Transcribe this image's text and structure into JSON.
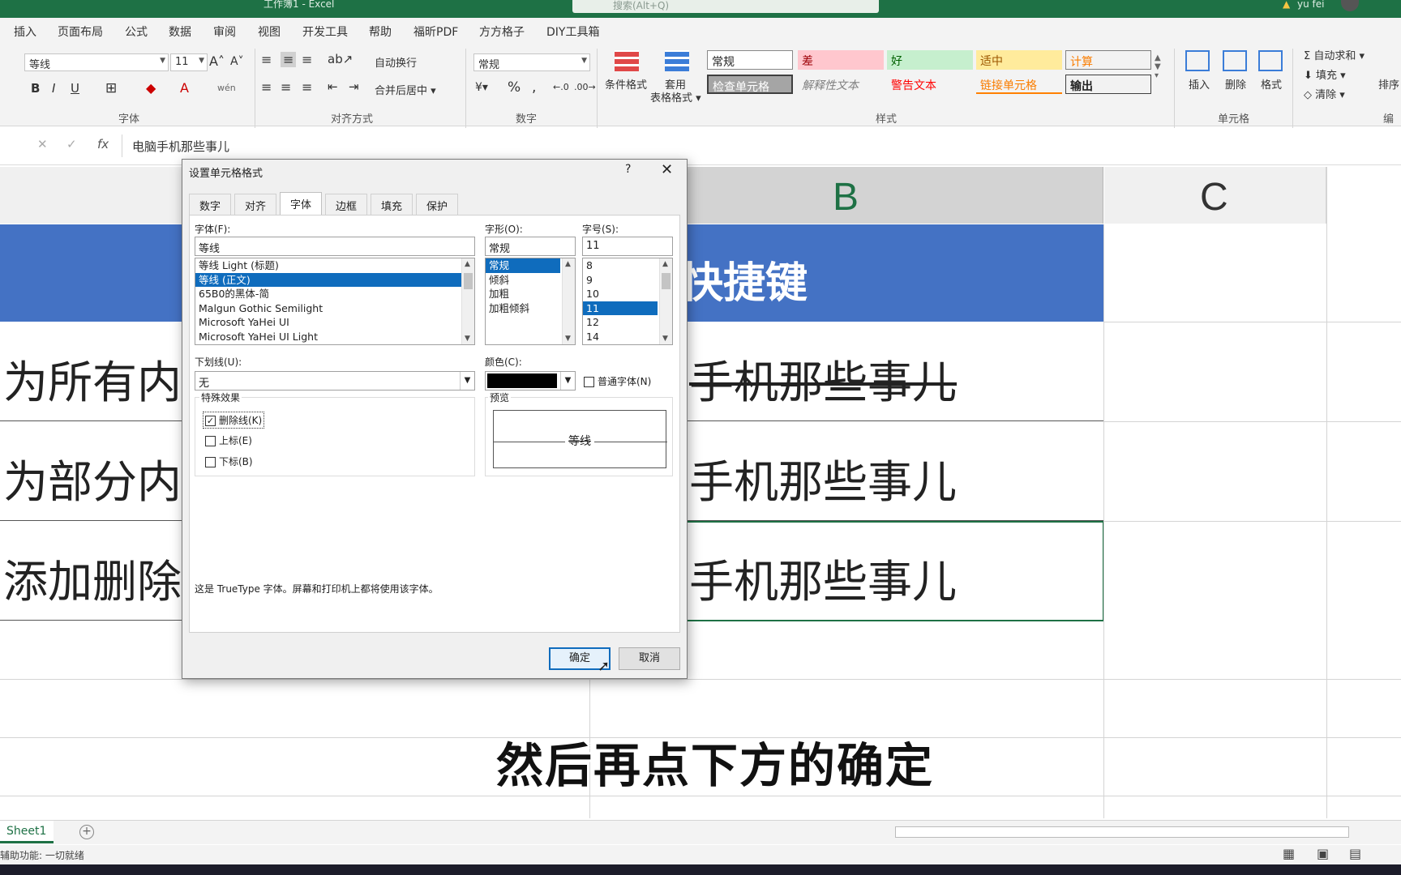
{
  "window": {
    "title": "工作簿1 - Excel",
    "search_placeholder": "搜索(Alt+Q)",
    "user": "yu fei"
  },
  "ribbon": {
    "menus": [
      "插入",
      "页面布局",
      "公式",
      "数据",
      "审阅",
      "视图",
      "开发工具",
      "帮助",
      "福昕PDF",
      "方方格子",
      "DIY工具箱"
    ],
    "font_name": "等线",
    "font_size": "11",
    "wrap_text": "自动换行",
    "merge_center": "合并后居中",
    "number_format": "常规",
    "conditional_format": "条件格式",
    "table_format": "套用\n表格格式",
    "styles": {
      "normal": "常规",
      "bad": "差",
      "good": "好",
      "neutral": "适中",
      "calc": "计算",
      "check": "检查单元格",
      "explain": "解释性文本",
      "warn": "警告文本",
      "link": "链接单元格",
      "output": "输出"
    },
    "insert": "插入",
    "delete": "删除",
    "format": "格式",
    "autosum": "自动求和",
    "fill": "填充",
    "clear": "清除",
    "sort": "排序",
    "groups": {
      "font": "字体",
      "align": "对齐方式",
      "number": "数字",
      "styles": "样式",
      "cells": "单元格",
      "edit": "编辑"
    }
  },
  "formula_bar": {
    "content": "电脑手机那些事儿",
    "fx": "fx"
  },
  "sheet": {
    "col_b": "B",
    "col_c": "C",
    "header_b": "快捷键",
    "rows": [
      {
        "a": "为所有内",
        "b": "手机那些事儿",
        "strike": true
      },
      {
        "a": "为部分内",
        "b": "手机那些事儿",
        "strike": false
      },
      {
        "a": "添加删除",
        "b": "手机那些事儿",
        "strike": false
      }
    ]
  },
  "subtitle": "然后再点下方的确定",
  "dialog": {
    "title": "设置单元格格式",
    "help": "?",
    "close": "✕",
    "tabs": [
      "数字",
      "对齐",
      "字体",
      "边框",
      "填充",
      "保护"
    ],
    "active_tab": "字体",
    "font_label": "字体(F):",
    "font_value": "等线",
    "font_list": [
      "等线 Light (标题)",
      "等线 (正文)",
      "65B0的黑体-简",
      "Malgun Gothic Semilight",
      "Microsoft YaHei UI",
      "Microsoft YaHei UI Light"
    ],
    "style_label": "字形(O):",
    "style_value": "常规",
    "style_list": [
      "常规",
      "倾斜",
      "加粗",
      "加粗倾斜"
    ],
    "size_label": "字号(S):",
    "size_value": "11",
    "size_list": [
      "8",
      "9",
      "10",
      "11",
      "12",
      "14"
    ],
    "underline_label": "下划线(U):",
    "underline_value": "无",
    "color_label": "颜色(C):",
    "normal_font": "普通字体(N)",
    "effects_label": "特殊效果",
    "strikethrough": "删除线(K)",
    "superscript": "上标(E)",
    "subscript": "下标(B)",
    "preview_label": "预览",
    "preview_text": "等线",
    "info": "这是 TrueType 字体。屏幕和打印机上都将使用该字体。",
    "ok": "确定",
    "cancel": "取消"
  },
  "bottom": {
    "sheet_tab": "Sheet1",
    "status": "辅助功能: 一切就绪",
    "add": "+"
  },
  "colors": {
    "excel_green": "#1e7145",
    "header_blue": "#4472c4",
    "select_blue": "#0f6cbd"
  }
}
